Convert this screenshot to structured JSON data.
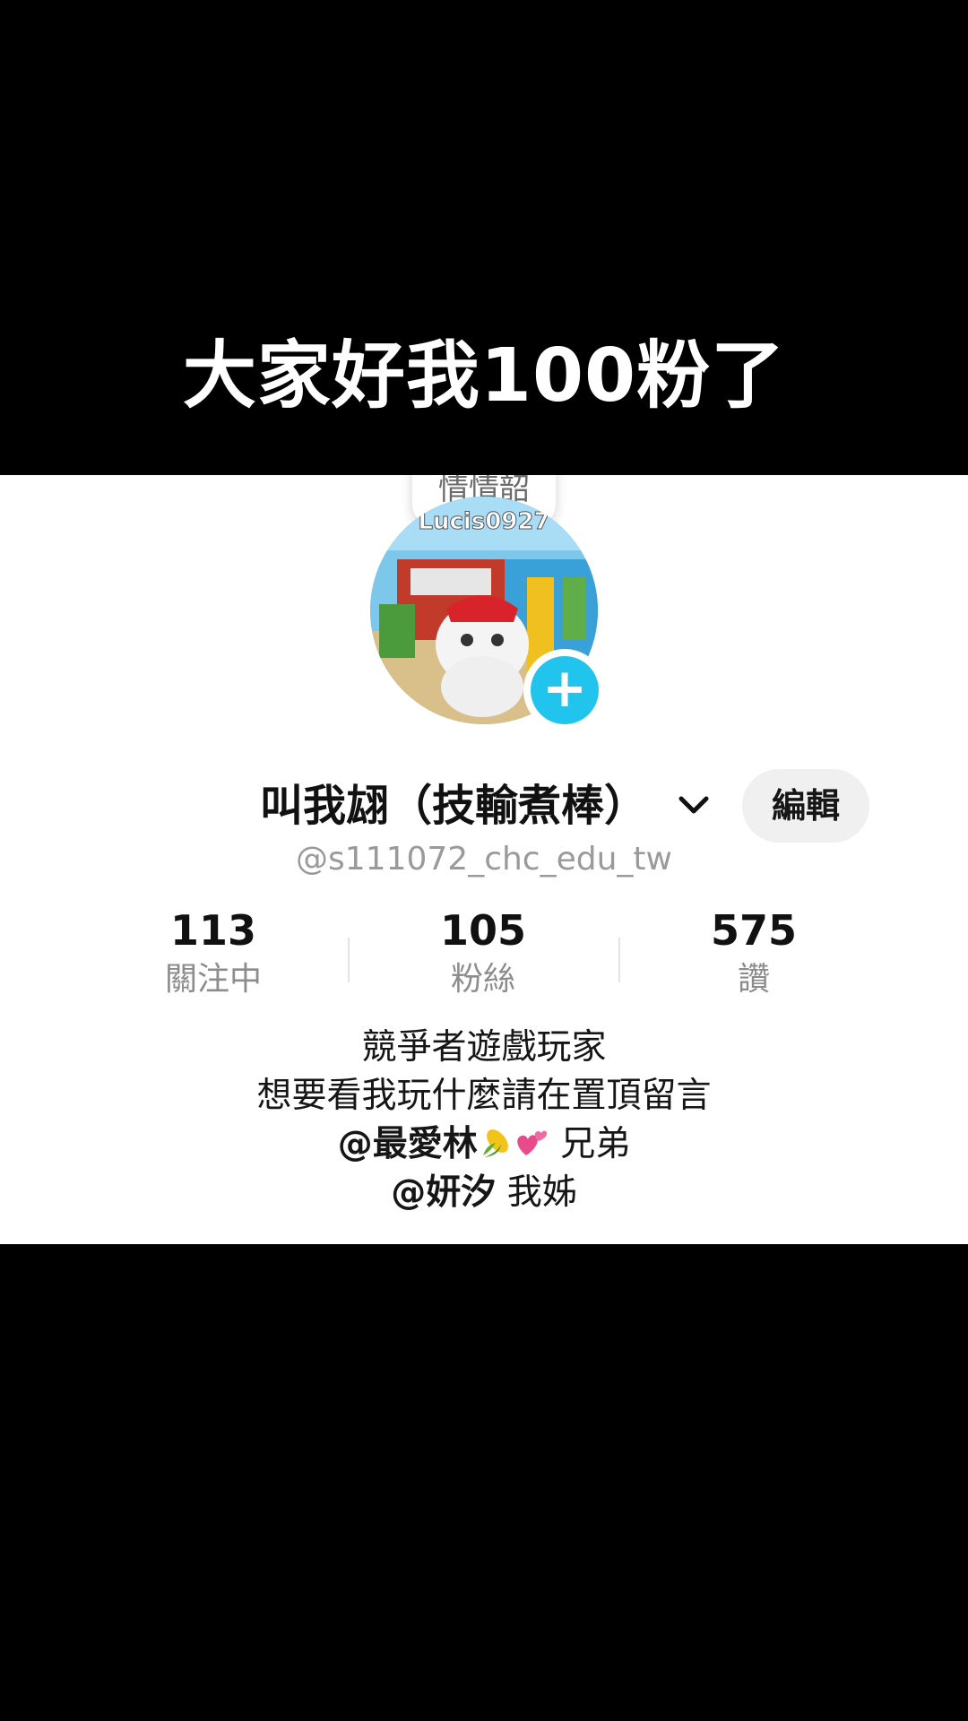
{
  "caption": "大家好我100粉了",
  "profile": {
    "note_text": "情情韶",
    "name": "叫我翃（技輸煮棒）",
    "handle": "@s111072_chc_edu_tw",
    "edit_label": "編輯",
    "add_icon": "plus-icon",
    "stats": [
      {
        "value": "113",
        "label": "關注中"
      },
      {
        "value": "105",
        "label": "粉絲"
      },
      {
        "value": "575",
        "label": "讚"
      }
    ],
    "bio": {
      "line1": "競爭者遊戲玩家",
      "line2": "想要看我玩什麼請在置頂留言",
      "line3_mention": "@最愛林",
      "line3_suffix": "兄弟",
      "line4_mention": "@妍汐",
      "line4_suffix": "我姊"
    }
  },
  "colors": {
    "background": "#000000",
    "card": "#ffffff",
    "accent": "#21c4ec",
    "muted_text": "#9a9a9a"
  }
}
